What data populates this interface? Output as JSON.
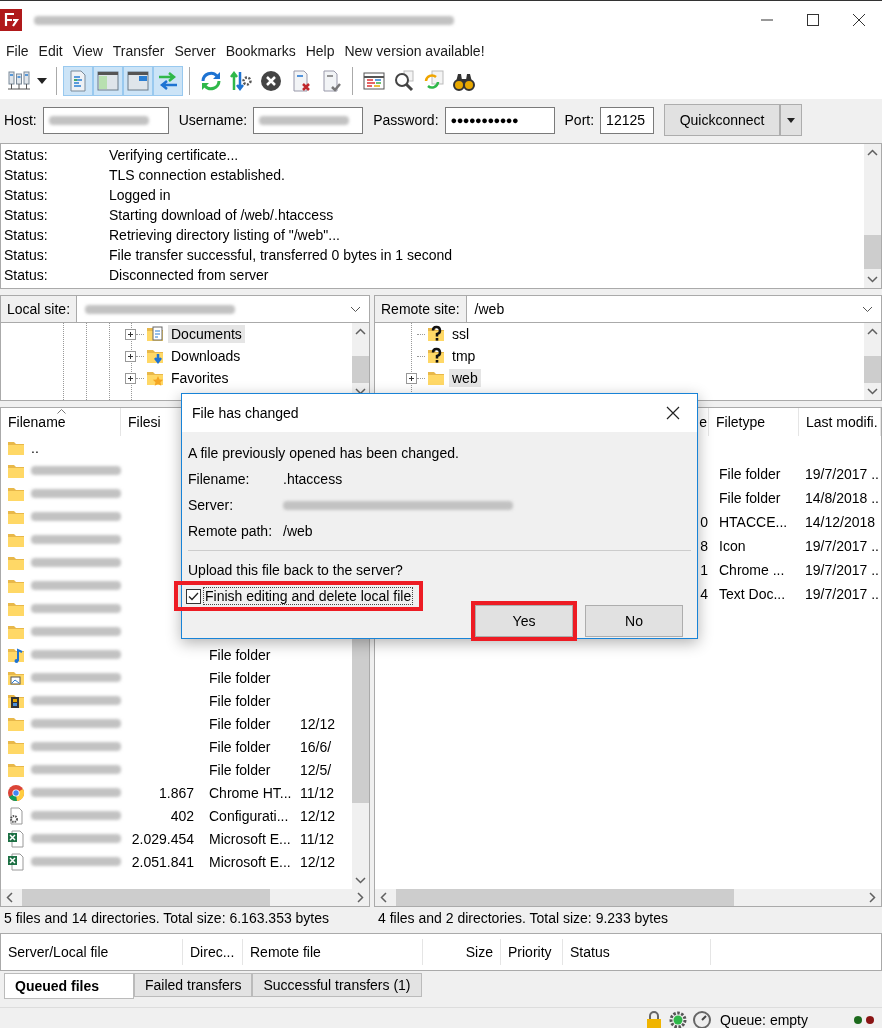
{
  "menu": [
    "File",
    "Edit",
    "View",
    "Transfer",
    "Server",
    "Bookmarks",
    "Help",
    "New version available!"
  ],
  "toolbar_groups": [
    {
      "buttons": [
        {
          "kind": "servers",
          "pressed": false
        }
      ]
    },
    {
      "buttons": [
        {
          "kind": "log",
          "pressed": true
        },
        {
          "kind": "localtree",
          "pressed": true
        },
        {
          "kind": "remotetree",
          "pressed": true
        },
        {
          "kind": "queue",
          "pressed": true
        }
      ]
    },
    {
      "buttons": [
        {
          "kind": "refresh",
          "pressed": false
        },
        {
          "kind": "process",
          "pressed": false
        },
        {
          "kind": "cancel",
          "pressed": false
        },
        {
          "kind": "disconnect",
          "pressed": false
        },
        {
          "kind": "reconnect",
          "pressed": false
        }
      ]
    },
    {
      "buttons": [
        {
          "kind": "filter",
          "pressed": false
        },
        {
          "kind": "search",
          "pressed": false
        },
        {
          "kind": "compare",
          "pressed": false
        },
        {
          "kind": "binoculars",
          "pressed": false
        }
      ]
    }
  ],
  "quickconnect": {
    "host_label": "Host:",
    "username_label": "Username:",
    "password_label": "Password:",
    "password_value": "●●●●●●●●●●●",
    "port_label": "Port:",
    "port_value": "12125",
    "button": "Quickconnect"
  },
  "message_log": [
    {
      "label": "Status:",
      "message": "Verifying certificate..."
    },
    {
      "label": "Status:",
      "message": "TLS connection established."
    },
    {
      "label": "Status:",
      "message": "Logged in"
    },
    {
      "label": "Status:",
      "message": "Starting download of /web/.htaccess"
    },
    {
      "label": "Status:",
      "message": "Retrieving directory listing of \"/web\"..."
    },
    {
      "label": "Status:",
      "message": "File transfer successful, transferred 0 bytes in 1 second"
    },
    {
      "label": "Status:",
      "message": "Disconnected from server"
    }
  ],
  "local_site": {
    "label": "Local site:",
    "tree": [
      {
        "label": "Documents",
        "kind": "documents",
        "selected": true,
        "has_children": true
      },
      {
        "label": "Downloads",
        "kind": "downloads",
        "selected": false,
        "has_children": true
      },
      {
        "label": "Favorites",
        "kind": "favorites",
        "selected": false,
        "has_children": true
      }
    ]
  },
  "remote_site": {
    "label": "Remote site:",
    "path": "/web",
    "tree": [
      {
        "label": "ssl",
        "kind": "unknown",
        "selected": false,
        "has_children": false
      },
      {
        "label": "tmp",
        "kind": "unknown",
        "selected": false,
        "has_children": false
      },
      {
        "label": "web",
        "kind": "folder",
        "selected": true,
        "has_children": true
      }
    ]
  },
  "local_files": {
    "columns": [
      "Filename",
      "Filesi"
    ],
    "rows": [
      {
        "kind": "folder",
        "name": ".."
      },
      {
        "kind": "folder"
      },
      {
        "kind": "folder"
      },
      {
        "kind": "folder"
      },
      {
        "kind": "folder"
      },
      {
        "kind": "folder"
      },
      {
        "kind": "folder"
      },
      {
        "kind": "folder"
      },
      {
        "kind": "folder"
      },
      {
        "kind": "music",
        "type": "File folder"
      },
      {
        "kind": "pictures",
        "type": "File folder"
      },
      {
        "kind": "videos",
        "type": "File folder"
      },
      {
        "kind": "folder",
        "type": "File folder",
        "modified": "12/12"
      },
      {
        "kind": "folder",
        "type": "File folder",
        "modified": "16/6/"
      },
      {
        "kind": "folder",
        "type": "File folder",
        "modified": "12/5/"
      },
      {
        "kind": "chrome",
        "size": "1.867",
        "type": "Chrome HT...",
        "modified": "11/12"
      },
      {
        "kind": "config",
        "size": "402",
        "type": "Configurati...",
        "modified": "12/12"
      },
      {
        "kind": "excel",
        "size": "2.029.454",
        "type": "Microsoft E...",
        "modified": "11/12"
      },
      {
        "kind": "excel",
        "size": "2.051.841",
        "type": "Microsoft E...",
        "modified": "12/12"
      }
    ],
    "summary": "5 files and 14 directories. Total size: 6.163.353 bytes"
  },
  "remote_files": {
    "columns": [
      "e",
      "Filetype",
      "Last modifi."
    ],
    "rows": [
      {
        "type": "File folder",
        "modified": "19/7/2017 .."
      },
      {
        "type": "File folder",
        "modified": "14/8/2018 .."
      },
      {
        "size": "0",
        "type": "HTACCE...",
        "modified": "14/12/2018"
      },
      {
        "size": "8",
        "type": "Icon",
        "modified": "19/7/2017 .."
      },
      {
        "size": "1",
        "type": "Chrome ...",
        "modified": "19/7/2017 .."
      },
      {
        "size": "4",
        "type": "Text Doc...",
        "modified": "19/7/2017 .."
      }
    ],
    "summary": "4 files and 2 directories. Total size: 9.233 bytes"
  },
  "queue": {
    "columns": [
      "Server/Local file",
      "Direc...",
      "Remote file",
      "Size",
      "Priority",
      "Status"
    ],
    "tabs": [
      {
        "label": "Queued files",
        "selected": true
      },
      {
        "label": "Failed transfers",
        "selected": false
      },
      {
        "label": "Successful transfers (1)",
        "selected": false
      }
    ]
  },
  "status_bar": {
    "queue": "Queue: empty"
  },
  "dialog": {
    "title": "File has changed",
    "message": "A file previously opened has been changed.",
    "fields": [
      {
        "label": "Filename:",
        "value": ".htaccess"
      },
      {
        "label": "Server:"
      },
      {
        "label": "Remote path:",
        "value": "/web"
      }
    ],
    "question": "Upload this file back to the server?",
    "checkbox": {
      "label": "Finish editing and delete local file",
      "checked": true,
      "highlighted": true
    },
    "buttons": [
      {
        "label": "Yes",
        "highlighted": true
      },
      {
        "label": "No",
        "highlighted": false
      }
    ]
  }
}
